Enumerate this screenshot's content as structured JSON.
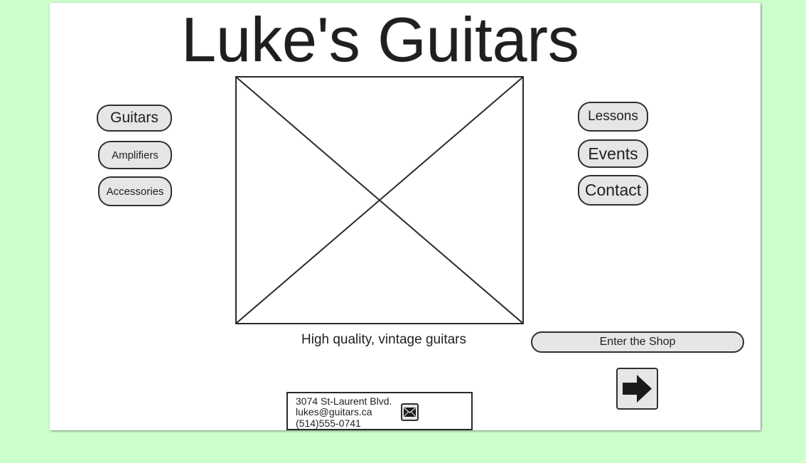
{
  "title": "Luke's Guitars",
  "left_nav": {
    "guitars": "Guitars",
    "amplifiers": "Amplifiers",
    "accessories": "Accessories"
  },
  "right_nav": {
    "lessons": "Lessons",
    "events": "Events",
    "contact": "Contact"
  },
  "hero": {
    "image_icon": "image-placeholder-icon",
    "tagline": "High quality, vintage guitars"
  },
  "shop": {
    "enter_label": "Enter the Shop",
    "arrow_icon": "arrow-right-icon"
  },
  "contact_info": {
    "address": "3074 St-Laurent Blvd.",
    "email": "lukes@guitars.ca",
    "phone": "(514)555-0741",
    "mail_icon": "envelope-icon"
  },
  "colors": {
    "background": "#ccffcc",
    "page": "#ffffff",
    "button_fill": "#e6e6e6",
    "stroke": "#2f2f2f"
  }
}
